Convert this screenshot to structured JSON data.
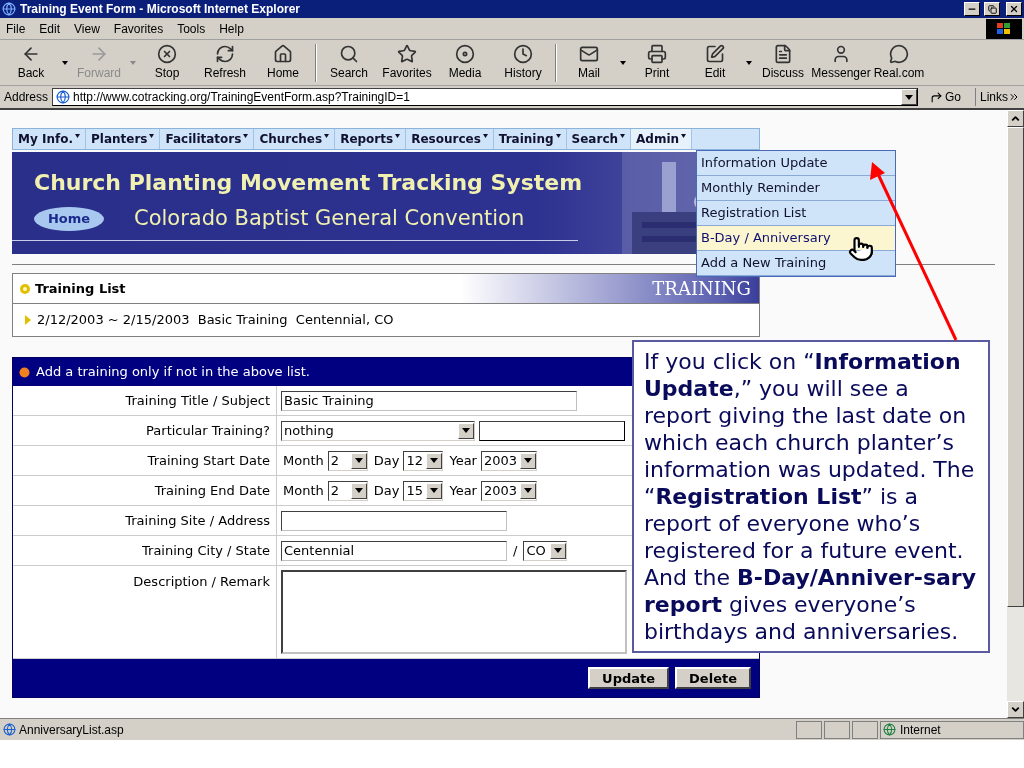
{
  "window": {
    "title": "Training Event Form - Microsoft Internet Explorer"
  },
  "menu": [
    "File",
    "Edit",
    "View",
    "Favorites",
    "Tools",
    "Help"
  ],
  "toolbar": [
    {
      "label": "Back",
      "disabled": false,
      "dropdown": true
    },
    {
      "label": "Forward",
      "disabled": true,
      "dropdown": true
    },
    {
      "label": "Stop",
      "disabled": false,
      "dropdown": false
    },
    {
      "label": "Refresh",
      "disabled": false,
      "dropdown": false
    },
    {
      "label": "Home",
      "disabled": false,
      "dropdown": false
    },
    {
      "label": "Search",
      "disabled": false,
      "dropdown": false
    },
    {
      "label": "Favorites",
      "disabled": false,
      "dropdown": false
    },
    {
      "label": "Media",
      "disabled": false,
      "dropdown": false
    },
    {
      "label": "History",
      "disabled": false,
      "dropdown": false
    },
    {
      "label": "Mail",
      "disabled": false,
      "dropdown": true
    },
    {
      "label": "Print",
      "disabled": false,
      "dropdown": false
    },
    {
      "label": "Edit",
      "disabled": false,
      "dropdown": true
    },
    {
      "label": "Discuss",
      "disabled": false,
      "dropdown": false
    },
    {
      "label": "Messenger",
      "disabled": false,
      "dropdown": false
    },
    {
      "label": "Real.com",
      "disabled": false,
      "dropdown": false
    }
  ],
  "address": {
    "label": "Address",
    "url": "http://www.cotracking.org/TrainingEventForm.asp?TrainingID=1",
    "go": "Go",
    "links": "Links"
  },
  "nav": [
    {
      "label": "My Info.",
      "expanded": false
    },
    {
      "label": "Planters",
      "expanded": false
    },
    {
      "label": "Facilitators",
      "expanded": false
    },
    {
      "label": "Churches",
      "expanded": false
    },
    {
      "label": "Reports",
      "expanded": false
    },
    {
      "label": "Resources",
      "expanded": false
    },
    {
      "label": "Training",
      "expanded": false
    },
    {
      "label": "Search",
      "expanded": false
    },
    {
      "label": "Admin",
      "expanded": true
    }
  ],
  "admin_menu": [
    {
      "label": "Information Update",
      "selected": false
    },
    {
      "label": "Monthly Reminder",
      "selected": false
    },
    {
      "label": "Registration List",
      "selected": false
    },
    {
      "label": "B-Day / Anniversary",
      "selected": true
    },
    {
      "label": "Add a New Training",
      "selected": false
    }
  ],
  "banner": {
    "title": "Church Planting Movement Tracking System",
    "home": "Home",
    "subtitle": "Colorado Baptist General Convention"
  },
  "training_list": {
    "title": "Training List",
    "tag": "TRAINING",
    "items": [
      "2/12/2003 ~ 2/15/2003  Basic Training  Centennial, CO"
    ]
  },
  "form": {
    "header": "Add a training only if not in the above list.",
    "rows": [
      {
        "kind": "text",
        "label": "Training Title / Subject",
        "value": "Basic Training"
      },
      {
        "kind": "select_text",
        "label": "Particular Training?",
        "value": "nothing"
      },
      {
        "kind": "date",
        "label": "Training Start Date",
        "parts": [
          {
            "label": "Month",
            "value": "2"
          },
          {
            "label": "Day",
            "value": "12"
          },
          {
            "label": "Year",
            "value": "2003"
          }
        ]
      },
      {
        "kind": "date",
        "label": "Training End Date",
        "parts": [
          {
            "label": "Month",
            "value": "2"
          },
          {
            "label": "Day",
            "value": "15"
          },
          {
            "label": "Year",
            "value": "2003"
          }
        ]
      },
      {
        "kind": "text",
        "label": "Training Site / Address",
        "value": ""
      },
      {
        "kind": "city",
        "label": "Training City / State",
        "value": "Centennial",
        "separator": "/",
        "state": "CO"
      },
      {
        "kind": "textarea",
        "label": "Description / Remark",
        "value": ""
      }
    ],
    "buttons": [
      "Update",
      "Delete"
    ]
  },
  "callout": {
    "text": "If you click on “**Information Update**,” you will see a report giving the last date on which each church planter’s information was updated. The “**Registration List**” is a report of everyone who’s registered for a future event. And the **B-Day/Anniver-sary report** gives everyone’s birthdays and anniversaries."
  },
  "status_bar": {
    "text": "AnniversaryList.asp",
    "zone": "Internet"
  }
}
